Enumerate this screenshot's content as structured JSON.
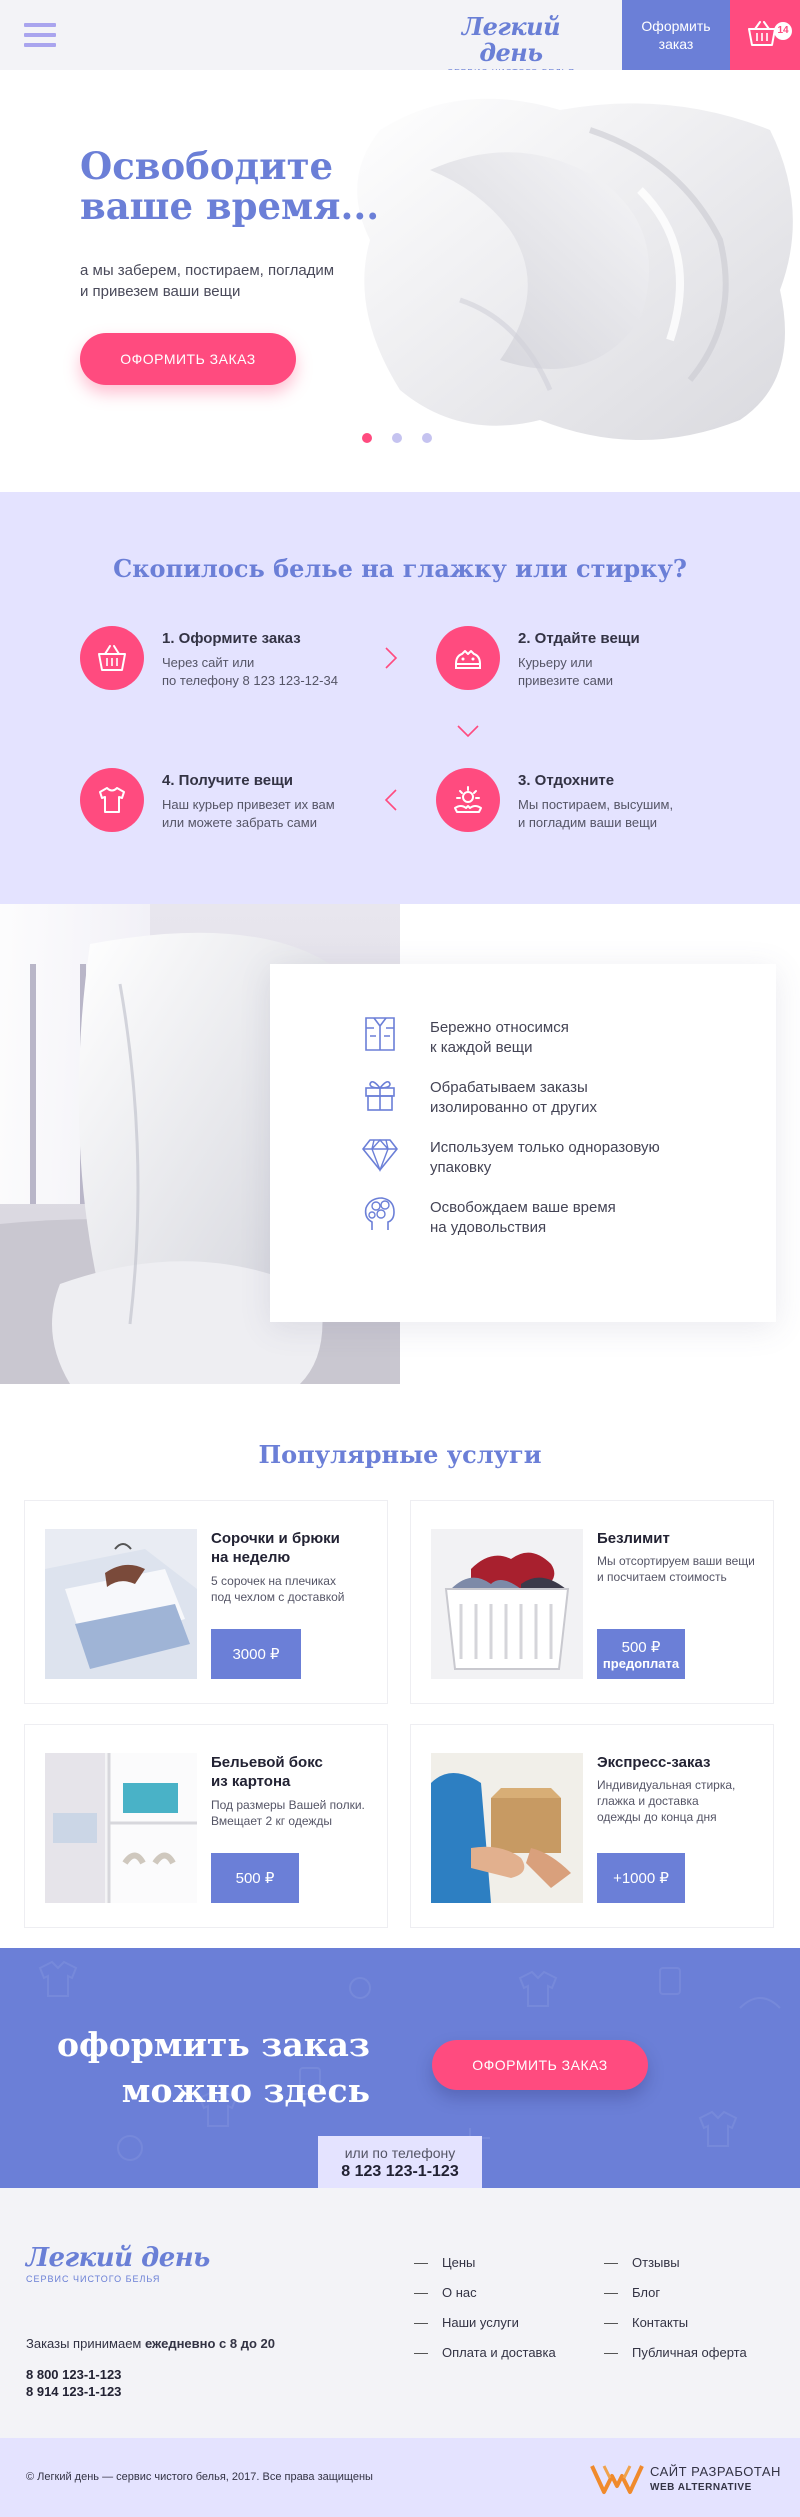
{
  "header": {
    "logo_name": "Легкий день",
    "logo_sub": "сервис чистого белья",
    "order_button": "Оформить заказ",
    "cart_count": "14"
  },
  "hero": {
    "title_line1": "Освободите",
    "title_line2": "ваше время...",
    "text_line1": "а мы заберем, постираем, погладим",
    "text_line2": "и привезем ваши вещи",
    "button": "Оформить заказ",
    "slides": 3,
    "active_slide": 1
  },
  "steps": {
    "title": "Скопилось белье на глажку или стирку?",
    "items": [
      {
        "title": "1. Оформите заказ",
        "line1": "Через сайт или",
        "line2": "по телефону 8 123 123-12-34",
        "icon": "basket-icon"
      },
      {
        "title": "2. Отдайте вещи",
        "line1": "Курьеру или",
        "line2": "привезите сами",
        "icon": "clothes-pile-icon"
      },
      {
        "title": "3. Отдохните",
        "line1": "Мы постираем, высушим,",
        "line2": "и погладим ваши вещи",
        "icon": "sun-hands-icon"
      },
      {
        "title": "4. Получите вещи",
        "line1": "Наш курьер привезет их вам",
        "line2": "или можете забрать сами",
        "icon": "shirt-icon"
      }
    ]
  },
  "features": {
    "items": [
      {
        "line1": "Бережно относимся",
        "line2": "к каждой вещи",
        "icon": "shirt-outline-icon"
      },
      {
        "line1": "Обрабатываем заказы",
        "line2": "изолированно от других",
        "icon": "gift-icon"
      },
      {
        "line1": "Используем только одноразовую",
        "line2": "упаковку",
        "icon": "diamond-icon"
      },
      {
        "line1": "Освобождаем ваше время",
        "line2": "на удовольствия",
        "icon": "head-flowers-icon"
      }
    ]
  },
  "services": {
    "title": "Популярные услуги",
    "cards": [
      {
        "title_line1": "Сорочки и брюки",
        "title_line2": "на неделю",
        "desc_line1": "5 сорочек на плечиках",
        "desc_line2": "под чехлом с доставкой",
        "desc_line3": "",
        "price": "3000 ₽",
        "price_sub": ""
      },
      {
        "title_line1": "Безлимит",
        "title_line2": "",
        "desc_line1": "Мы отсортируем ваши вещи",
        "desc_line2": "и посчитаем стоимость",
        "desc_line3": "",
        "price": "500 ₽",
        "price_sub": "предоплата"
      },
      {
        "title_line1": "Бельевой бокс",
        "title_line2": "из картона",
        "desc_line1": "Под размеры Вашей полки.",
        "desc_line2": "Вмещает 2 кг одежды",
        "desc_line3": "",
        "price": "500 ₽",
        "price_sub": ""
      },
      {
        "title_line1": "Экспресс-заказ",
        "title_line2": "",
        "desc_line1": "Индивидуальная стирка,",
        "desc_line2": "глажка и доставка",
        "desc_line3": "одежды до конца дня",
        "price": "+1000 ₽",
        "price_sub": ""
      }
    ]
  },
  "cta": {
    "title_line1": "оформить заказ",
    "title_line2": "можно здесь",
    "button": "Оформить заказ",
    "phone_label": "или по телефону",
    "phone": "8 123 123-1-123"
  },
  "footer": {
    "logo_name": "Легкий день",
    "logo_sub": "сервис чистого белья",
    "hours_prefix": "Заказы  принимаем ",
    "hours_bold": "ежедневно с 8 до 20",
    "phone1": "8 800 123-1-123",
    "phone2": "8 914  123-1-123",
    "nav_col1": [
      "Цены",
      "О нас",
      "Наши услуги",
      "Оплата и доставка"
    ],
    "nav_col2": [
      "Отзывы",
      "Блог",
      "Контакты",
      "Публичная оферта"
    ],
    "copyright": "© Легкий день — сервис чистого белья, 2017. Все права защищены",
    "dev_line1": "Сайт разработан",
    "dev_line2": "Web Alternative"
  },
  "colors": {
    "accent_blue": "#6b7fd7",
    "accent_pink": "#ff4b7f",
    "lavender": "#e4e3ff"
  }
}
